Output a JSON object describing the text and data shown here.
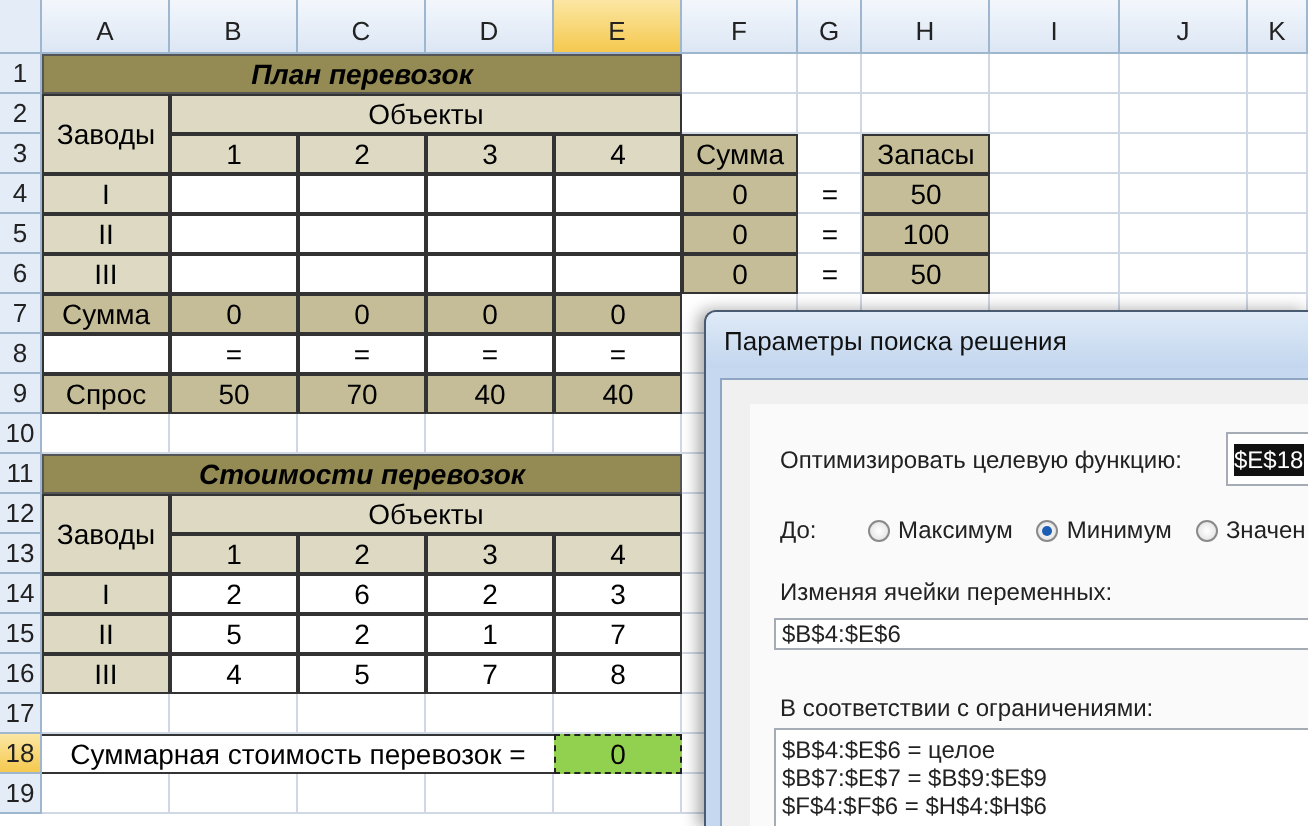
{
  "sheet": {
    "columns": [
      {
        "label": "A",
        "selected": false
      },
      {
        "label": "B",
        "selected": false
      },
      {
        "label": "C",
        "selected": false
      },
      {
        "label": "D",
        "selected": false
      },
      {
        "label": "E",
        "selected": true
      },
      {
        "label": "F",
        "selected": false
      },
      {
        "label": "G",
        "selected": false
      },
      {
        "label": "H",
        "selected": false
      },
      {
        "label": "I",
        "selected": false
      },
      {
        "label": "J",
        "selected": false
      },
      {
        "label": "K",
        "selected": false
      }
    ],
    "rows": [
      {
        "number": "1",
        "selected": false,
        "cells": [
          {
            "kind": "title",
            "text": "План перевозок"
          }
        ]
      },
      {
        "number": "2",
        "selected": false,
        "cells": [
          {
            "kind": "rowhead",
            "text": "Заводы"
          },
          {
            "kind": "group",
            "text": "Объекты"
          }
        ]
      },
      {
        "number": "3",
        "selected": false,
        "cells": [
          "",
          {
            "kind": "header",
            "text": "1"
          },
          {
            "kind": "header",
            "text": "2"
          },
          {
            "kind": "header",
            "text": "3"
          },
          {
            "kind": "header",
            "text": "4"
          },
          {
            "kind": "total",
            "text": "Сумма"
          },
          "",
          {
            "kind": "total",
            "text": "Запасы"
          }
        ]
      },
      {
        "number": "4",
        "selected": false,
        "cells": [
          {
            "kind": "header",
            "text": "I"
          },
          {
            "kind": "data"
          },
          {
            "kind": "data"
          },
          {
            "kind": "data"
          },
          {
            "kind": "data"
          },
          {
            "kind": "total",
            "text": "0"
          },
          {
            "kind": "plain",
            "text": "="
          },
          {
            "kind": "total",
            "text": "50"
          }
        ]
      },
      {
        "number": "5",
        "selected": false,
        "cells": [
          {
            "kind": "header",
            "text": "II"
          },
          {
            "kind": "data"
          },
          {
            "kind": "data"
          },
          {
            "kind": "data"
          },
          {
            "kind": "data"
          },
          {
            "kind": "total",
            "text": "0"
          },
          {
            "kind": "plain",
            "text": "="
          },
          {
            "kind": "total",
            "text": "100"
          }
        ]
      },
      {
        "number": "6",
        "selected": false,
        "cells": [
          {
            "kind": "header",
            "text": "III"
          },
          {
            "kind": "data"
          },
          {
            "kind": "data"
          },
          {
            "kind": "data"
          },
          {
            "kind": "data"
          },
          {
            "kind": "total",
            "text": "0"
          },
          {
            "kind": "plain",
            "text": "="
          },
          {
            "kind": "total",
            "text": "50"
          }
        ]
      },
      {
        "number": "7",
        "selected": false,
        "cells": [
          {
            "kind": "total",
            "text": "Сумма"
          },
          {
            "kind": "total",
            "text": "0"
          },
          {
            "kind": "total",
            "text": "0"
          },
          {
            "kind": "total",
            "text": "0"
          },
          {
            "kind": "total",
            "text": "0"
          }
        ]
      },
      {
        "number": "8",
        "selected": false,
        "cells": [
          {
            "kind": "data"
          },
          {
            "kind": "data",
            "text": "="
          },
          {
            "kind": "data",
            "text": "="
          },
          {
            "kind": "data",
            "text": "="
          },
          {
            "kind": "data",
            "text": "="
          }
        ]
      },
      {
        "number": "9",
        "selected": false,
        "cells": [
          {
            "kind": "total",
            "text": "Спрос"
          },
          {
            "kind": "total",
            "text": "50"
          },
          {
            "kind": "total",
            "text": "70"
          },
          {
            "kind": "total",
            "text": "40"
          },
          {
            "kind": "total",
            "text": "40"
          }
        ]
      },
      {
        "number": "10",
        "selected": false,
        "cells": []
      },
      {
        "number": "11",
        "selected": false,
        "cells": [
          {
            "kind": "title",
            "text": "Стоимости перевозок"
          }
        ]
      },
      {
        "number": "12",
        "selected": false,
        "cells": [
          {
            "kind": "rowhead",
            "text": "Заводы"
          },
          {
            "kind": "group",
            "text": "Объекты"
          }
        ]
      },
      {
        "number": "13",
        "selected": false,
        "cells": [
          "",
          {
            "kind": "header",
            "text": "1"
          },
          {
            "kind": "header",
            "text": "2"
          },
          {
            "kind": "header",
            "text": "3"
          },
          {
            "kind": "header",
            "text": "4"
          }
        ]
      },
      {
        "number": "14",
        "selected": false,
        "cells": [
          {
            "kind": "header",
            "text": "I"
          },
          {
            "kind": "data",
            "text": "2"
          },
          {
            "kind": "data",
            "text": "6"
          },
          {
            "kind": "data",
            "text": "2"
          },
          {
            "kind": "data",
            "text": "3"
          }
        ]
      },
      {
        "number": "15",
        "selected": false,
        "cells": [
          {
            "kind": "header",
            "text": "II"
          },
          {
            "kind": "data",
            "text": "5"
          },
          {
            "kind": "data",
            "text": "2"
          },
          {
            "kind": "data",
            "text": "1"
          },
          {
            "kind": "data",
            "text": "7"
          }
        ]
      },
      {
        "number": "16",
        "selected": false,
        "cells": [
          {
            "kind": "header",
            "text": "III"
          },
          {
            "kind": "data",
            "text": "4"
          },
          {
            "kind": "data",
            "text": "5"
          },
          {
            "kind": "data",
            "text": "7"
          },
          {
            "kind": "data",
            "text": "8"
          }
        ]
      },
      {
        "number": "17",
        "selected": false,
        "cells": []
      },
      {
        "number": "18",
        "selected": true,
        "cells": [
          {
            "kind": "label",
            "text": "Суммарная стоимость перевозок ="
          },
          "",
          "",
          "",
          {
            "kind": "result",
            "text": "0"
          }
        ]
      },
      {
        "number": "19",
        "selected": false,
        "cells": []
      }
    ]
  },
  "dialog": {
    "title": "Параметры поиска решения",
    "objective_label": "Оптимизировать целевую функцию:",
    "objective_value": "$E$18",
    "to_label": "До:",
    "options": [
      {
        "label": "Максимум",
        "selected": false
      },
      {
        "label": "Минимум",
        "selected": true
      },
      {
        "label": "Значен",
        "selected": false
      }
    ],
    "variables_label": "Изменяя ячейки переменных:",
    "variables_value": "$B$4:$E$6",
    "constraints_label": "В соответствии с ограничениями:",
    "constraints": [
      "$B$4:$E$6 = целое",
      "$B$7:$E$7 = $B$9:$E$9",
      "$F$4:$F$6 = $H$4:$H$6"
    ]
  }
}
